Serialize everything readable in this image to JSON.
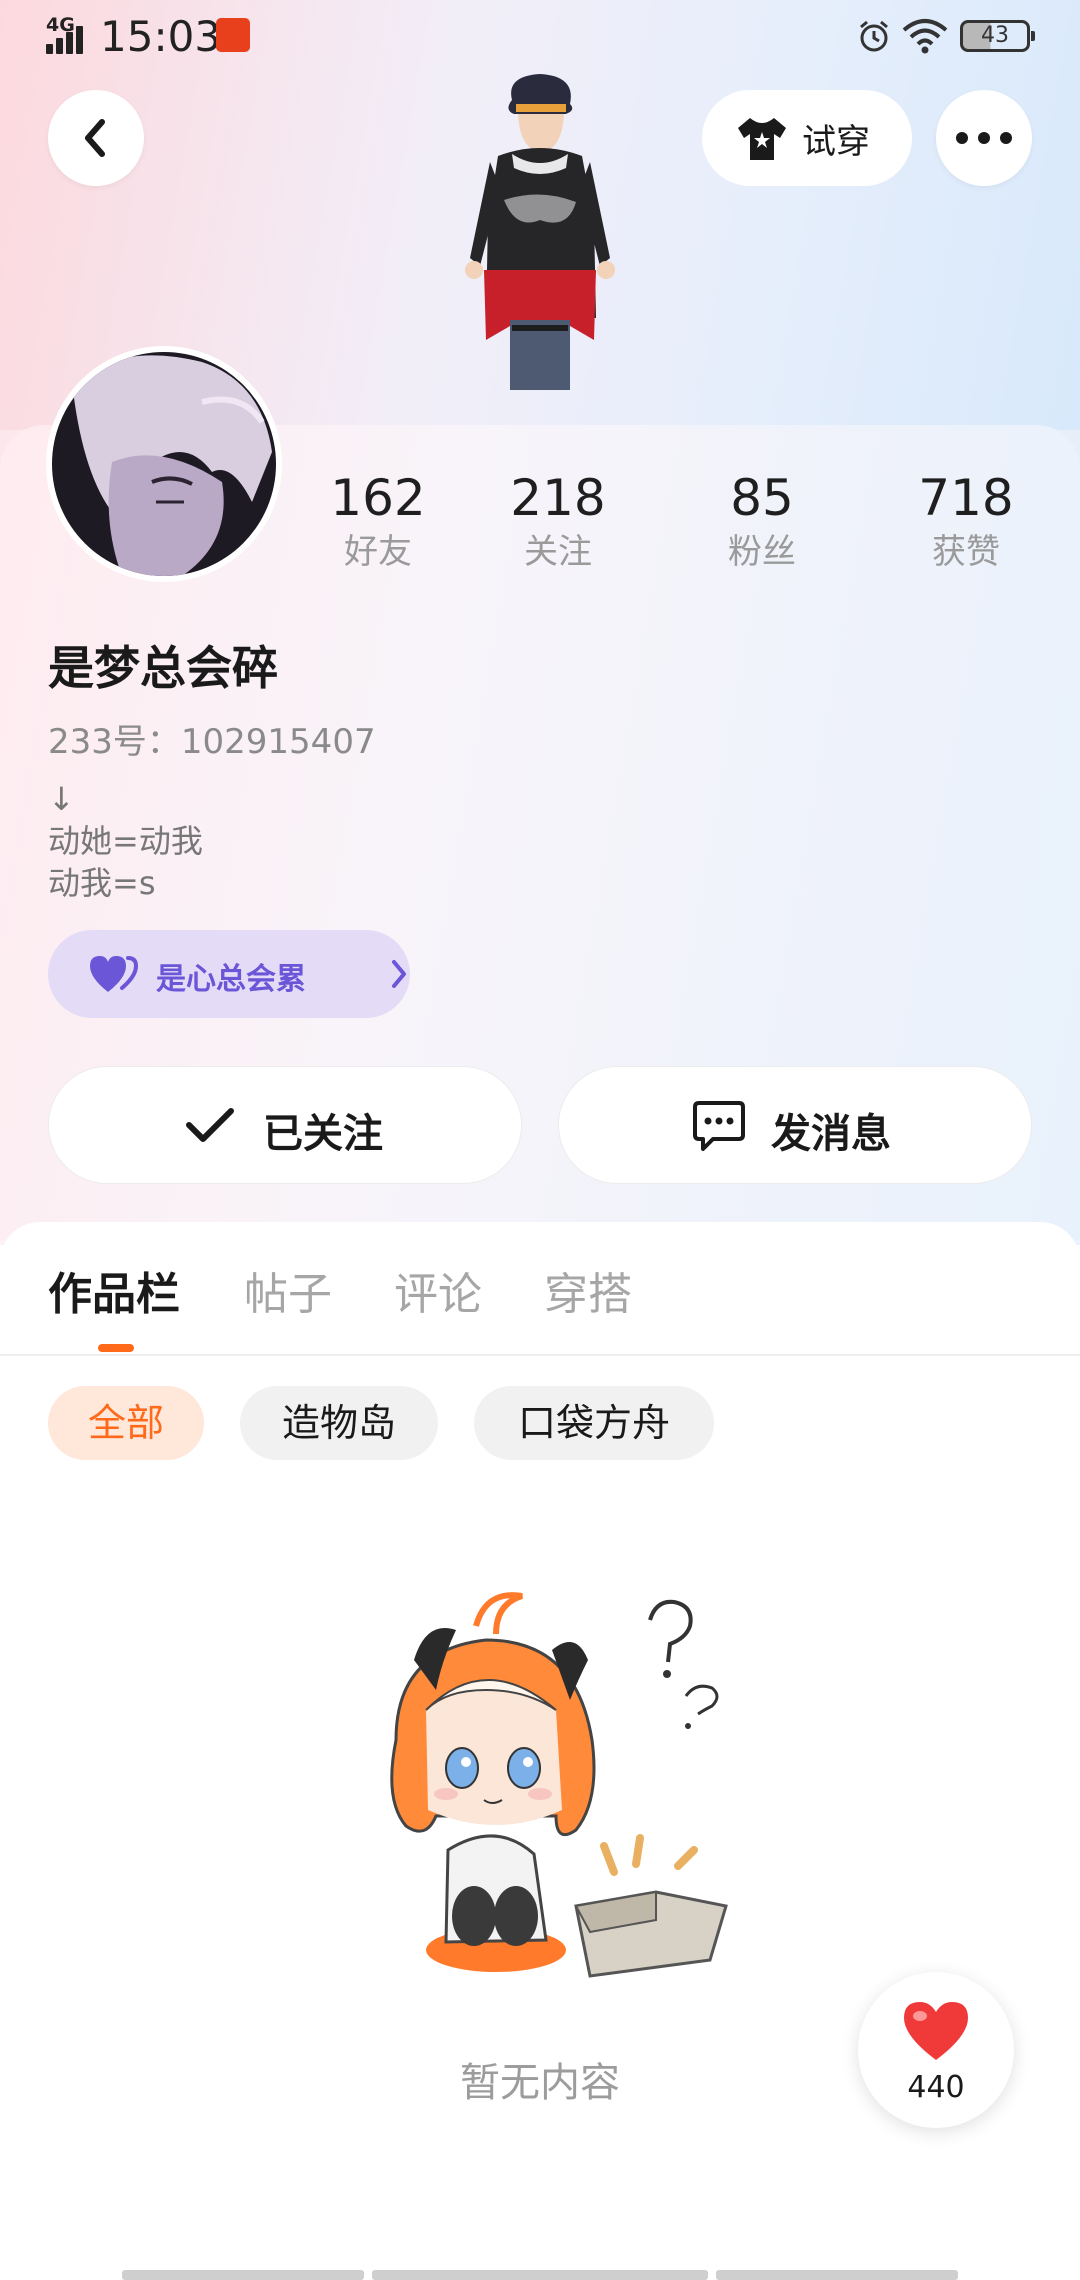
{
  "status_bar": {
    "network": "4G",
    "time": "15:03",
    "battery": "43"
  },
  "top_bar": {
    "back_icon": "back-arrow-icon",
    "tryon_label": "试穿",
    "tryon_icon": "tshirt-icon",
    "more_icon": "more-dots-icon"
  },
  "profile": {
    "stats": [
      {
        "value": "162",
        "label": "好友"
      },
      {
        "value": "218",
        "label": "关注"
      },
      {
        "value": "85",
        "label": "粉丝"
      },
      {
        "value": "718",
        "label": "获赞"
      }
    ],
    "username": "是梦总会碎",
    "uid": "233号：102915407",
    "bio": "↓\n动她=动我\n动我=s",
    "club_label": "是心总会累",
    "follow_label": "已关注",
    "message_label": "发消息"
  },
  "tabs": [
    {
      "label": "作品栏",
      "active": true
    },
    {
      "label": "帖子",
      "active": false
    },
    {
      "label": "评论",
      "active": false
    },
    {
      "label": "穿搭",
      "active": false
    }
  ],
  "filters": [
    {
      "label": "全部",
      "active": true
    },
    {
      "label": "造物岛",
      "active": false
    },
    {
      "label": "口袋方舟",
      "active": false
    }
  ],
  "empty_text": "暂无内容",
  "like_count": "440",
  "colors": {
    "accent": "#ff6a1a",
    "club_purple": "#6b56d8",
    "heart_red": "#f03a3a"
  }
}
